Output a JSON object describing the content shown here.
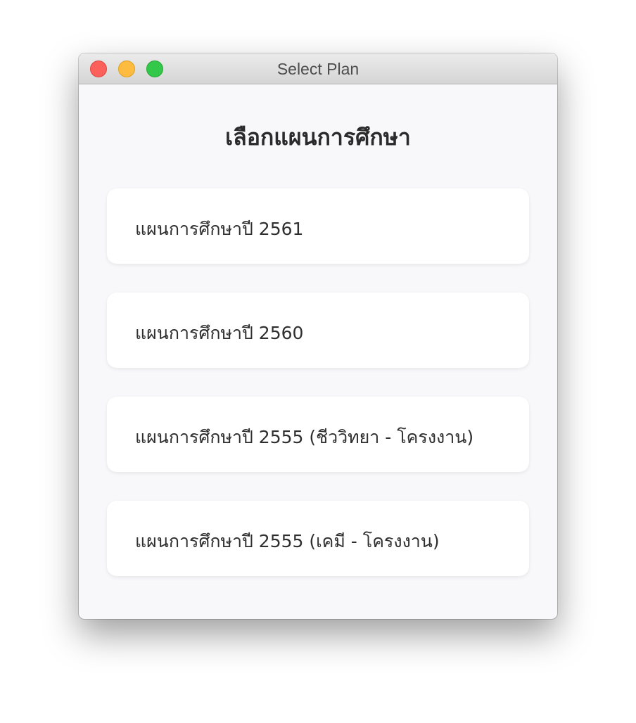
{
  "window": {
    "title": "Select Plan"
  },
  "page": {
    "heading": "เลือกแผนการศึกษา"
  },
  "plans": [
    {
      "label": "แผนการศึกษาปี 2561"
    },
    {
      "label": "แผนการศึกษาปี 2560"
    },
    {
      "label": "แผนการศึกษาปี 2555 (ชีววิทยา - โครงงาน)"
    },
    {
      "label": "แผนการศึกษาปี 2555 (เคมี - โครงงาน)"
    }
  ],
  "colors": {
    "close": "#fc605b",
    "minimize": "#fdbc40",
    "maximize": "#34c84a",
    "window_bg": "#f8f8fa",
    "card_bg": "#ffffff"
  }
}
